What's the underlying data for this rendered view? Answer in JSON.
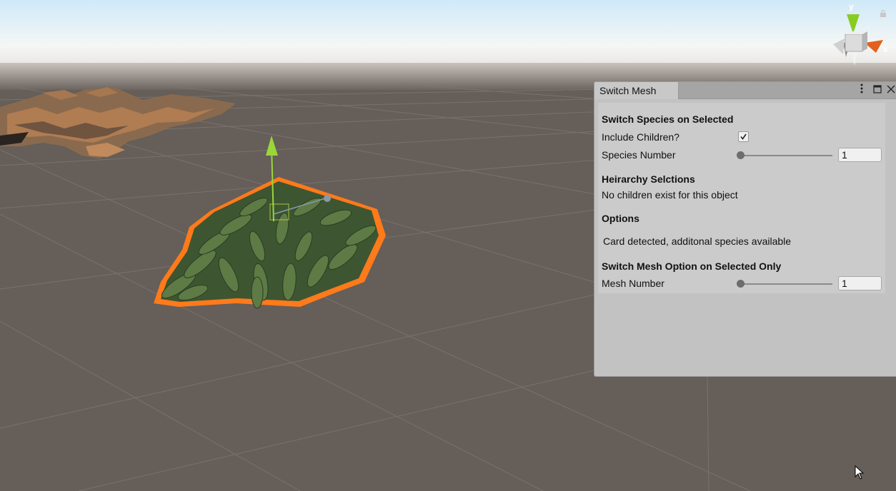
{
  "gizmo": {
    "y_label": "y",
    "x_label": "x",
    "lock_icon": "lock-icon"
  },
  "window": {
    "tab_title": "Switch Mesh",
    "menu_icon": "kebab-menu-icon",
    "maximize_icon": "maximize-icon",
    "close_icon": "close-icon",
    "section_species": {
      "header": "Switch Species on Selected",
      "include_children_label": "Include Children?",
      "include_children_checked": true,
      "species_number_label": "Species Number",
      "species_number_value": "1"
    },
    "section_hierarchy": {
      "header": "Heirarchy Selctions",
      "message": "No children exist for this object"
    },
    "section_options": {
      "header": "Options",
      "message": "Card detected, additonal species available"
    },
    "section_mesh": {
      "header": "Switch Mesh Option on Selected Only",
      "mesh_number_label": "Mesh Number",
      "mesh_number_value": "1"
    }
  },
  "colors": {
    "selection_outline": "#ff7a1a",
    "ground": "#655e59",
    "sky": "#dff0fa"
  }
}
